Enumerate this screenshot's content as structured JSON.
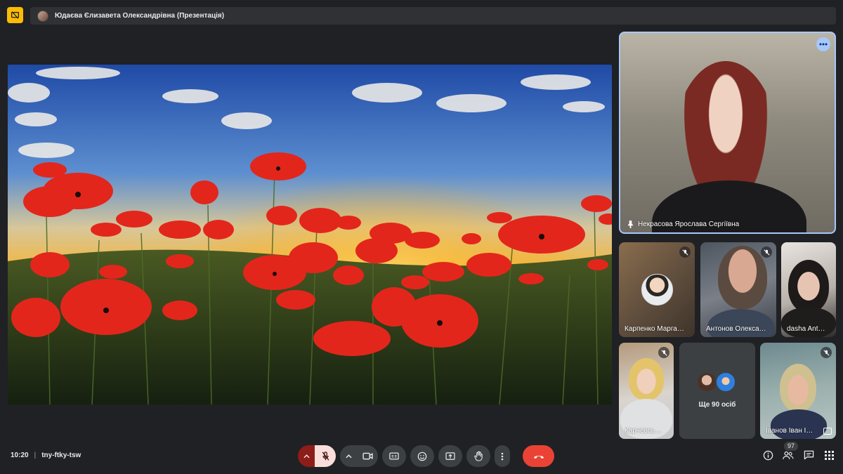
{
  "topbar": {
    "presenter_title": "Юдаєва Єлизавета Олександрівна (Презентація)",
    "present_icon": "stop-presenting-icon"
  },
  "participants": {
    "pinned": {
      "name": "Некрасова Ярослава Сергіївна",
      "more_icon": "more-horizontal-icon",
      "pin_icon": "pin-icon"
    },
    "karpenko": {
      "name": "Карпенко Марга…",
      "muted": true
    },
    "antonov": {
      "name": "Антонов Олекса…",
      "muted": true
    },
    "dasha": {
      "name": "dasha Ant…",
      "muted": false
    },
    "karchev": {
      "name": "Карчевсь…",
      "muted": true
    },
    "others": {
      "label": "Ще 90 осіб"
    },
    "ivanov": {
      "name": "Іванов Іван І…",
      "muted": true
    }
  },
  "footer": {
    "time": "10:20",
    "meeting_code": "tny-ftky-tsw",
    "participant_count": "97",
    "accent_leave": "#ea4335",
    "accent_mic_off": "#f9dedc"
  }
}
